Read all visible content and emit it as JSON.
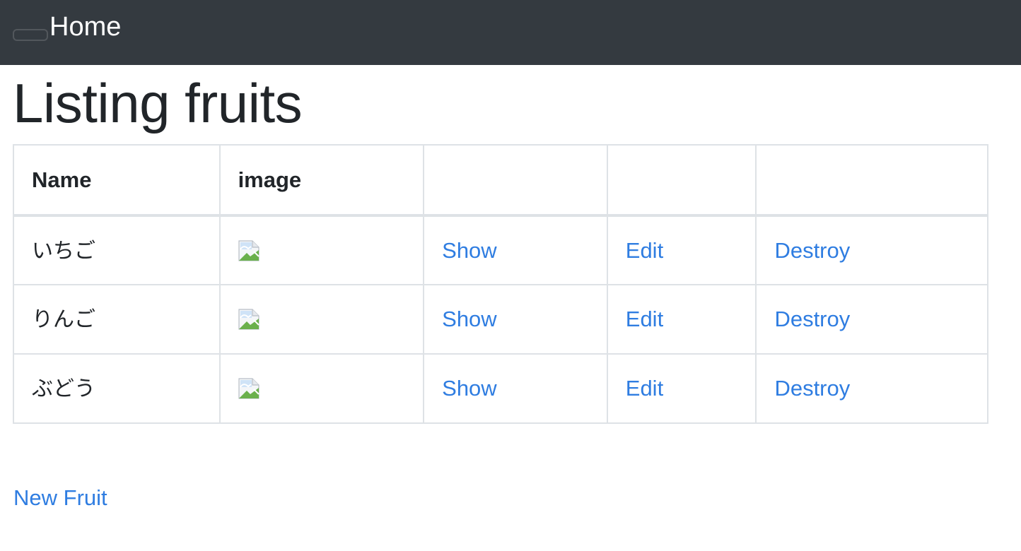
{
  "navbar": {
    "brand": "Home"
  },
  "page": {
    "title": "Listing fruits"
  },
  "table": {
    "columns": [
      "Name",
      "image",
      "",
      "",
      ""
    ],
    "rows": [
      {
        "name": "いちご",
        "show": "Show",
        "edit": "Edit",
        "destroy": "Destroy"
      },
      {
        "name": "りんご",
        "show": "Show",
        "edit": "Edit",
        "destroy": "Destroy"
      },
      {
        "name": "ぶどう",
        "show": "Show",
        "edit": "Edit",
        "destroy": "Destroy"
      }
    ]
  },
  "actions": {
    "new_label": "New Fruit"
  },
  "colors": {
    "navbar_bg": "#343a40",
    "link": "#2f7de1",
    "border": "#dee2e6"
  },
  "icons": {
    "image_cell": "broken-image-icon",
    "toggler": "navbar-toggler"
  }
}
